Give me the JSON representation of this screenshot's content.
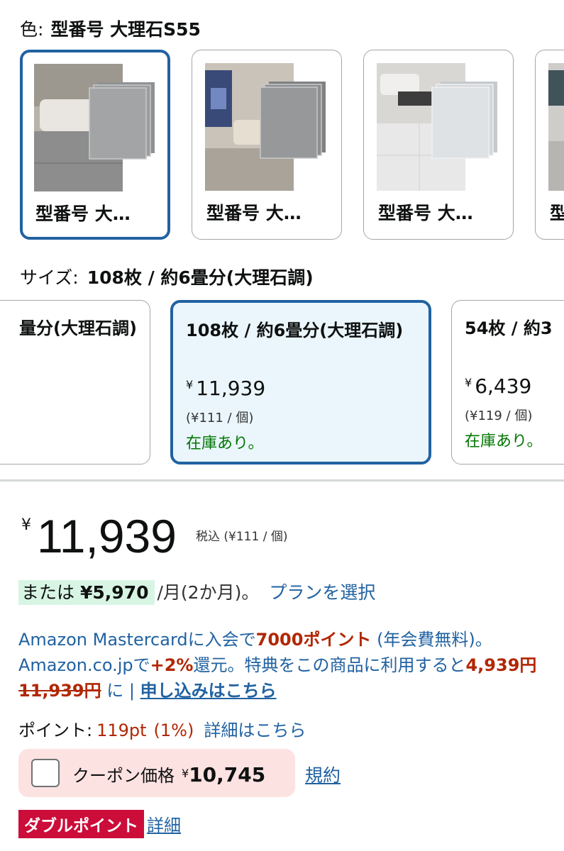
{
  "color": {
    "label": "色:",
    "value": "型番号 大理石S55",
    "swatches": [
      {
        "caption": "型番号 大…"
      },
      {
        "caption": "型番号 大…"
      },
      {
        "caption": "型番号 大…"
      },
      {
        "caption": "型"
      }
    ]
  },
  "size": {
    "label": "サイズ:",
    "value": "108枚 / 約6畳分(大理石調)",
    "options": [
      {
        "title": "量分(大理石調)"
      },
      {
        "title": "108枚 / 約6畳分(大理石調)",
        "yen": "¥",
        "price": "11,939",
        "unit": "(¥111 / 個)",
        "stock": "在庫あり。"
      },
      {
        "title": "54枚 / 約3",
        "yen": "¥",
        "price": "6,439",
        "unit": "(¥119 / 個)",
        "stock": "在庫あり。"
      }
    ]
  },
  "price": {
    "yen": "¥",
    "amount": "11,939",
    "tax_note": "税込 (¥111 / 個)"
  },
  "installment": {
    "prefix": "または",
    "amount": "¥5,970",
    "suffix": "/月(2か月)。",
    "link": "プランを選択"
  },
  "card_promo": {
    "t1": "Amazon Mastercardに入会で",
    "points": "7000ポイント",
    "t2": " (年会費無料)。 Amazon.co.jpで",
    "rate": "+2%",
    "t3": "還元。特典をこの商品に利用すると",
    "discounted": "4,939円",
    "original": "11,939円",
    "t4": " に | ",
    "link": "申し込みはこちら"
  },
  "points": {
    "label": "ポイント:",
    "value": "119pt",
    "percent": "(1%)",
    "link": "詳細はこちら"
  },
  "coupon": {
    "label": "クーポン価格",
    "yen": "¥",
    "amount": "10,745",
    "terms": "規約"
  },
  "double_points": {
    "badge": "ダブルポイント",
    "link": "詳細"
  },
  "colors": {
    "accent_blue": "#2162a1",
    "price_red": "#b12704",
    "stock_green": "#007600",
    "badge_red": "#cc0c39"
  }
}
